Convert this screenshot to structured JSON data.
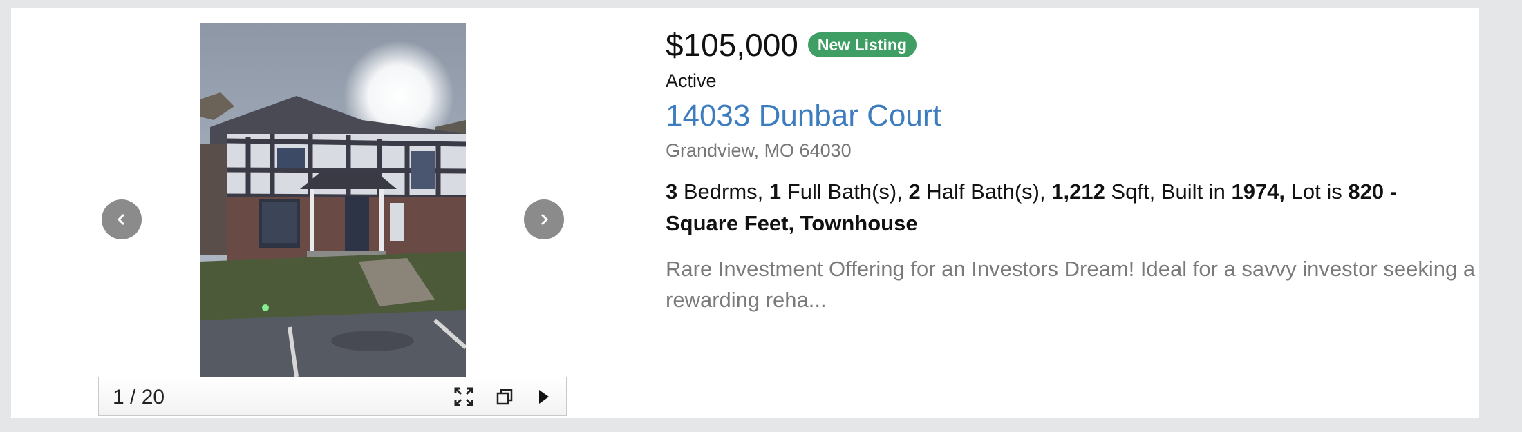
{
  "listing": {
    "price": "$105,000",
    "badge": "New Listing",
    "status": "Active",
    "address": "14033 Dunbar Court",
    "city_state_zip": "Grandview, MO 64030",
    "facts": {
      "beds": "3",
      "beds_label": " Bedrms, ",
      "full_baths": "1",
      "full_baths_label": " Full Bath(s), ",
      "half_baths": "2",
      "half_baths_label": " Half Bath(s), ",
      "sqft": "1,212",
      "sqft_label": " Sqft, Built in ",
      "year_built": "1974,",
      "lot_label": " Lot is ",
      "lot": "820 - Square Feet, Townhouse"
    },
    "description": "Rare Investment Offering for an Investors Dream! Ideal for a savvy investor seeking a rewarding reha..."
  },
  "gallery": {
    "counter": "1 / 20",
    "icons": {
      "prev": "chevron-left-icon",
      "next": "chevron-right-icon",
      "fullscreen": "fullscreen-icon",
      "new_window": "new-window-icon",
      "play": "play-icon"
    }
  },
  "colors": {
    "badge": "#3f9e64",
    "address_link": "#3d7dbf",
    "nav_button": "#8b8b8b",
    "page_background": "#e5e6e8"
  }
}
